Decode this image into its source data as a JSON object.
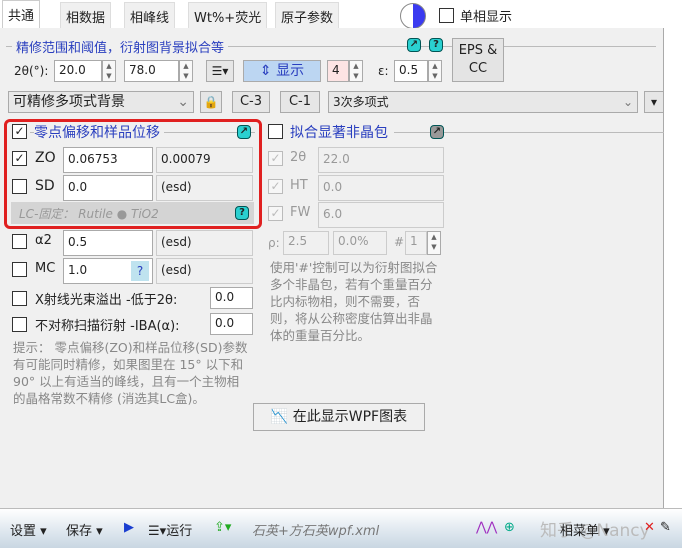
{
  "tabs": [
    "共通",
    "相数据",
    "相峰线",
    "Wt%+荧光",
    "原子参数"
  ],
  "single_phase": "单相显示",
  "range_section": {
    "title": "精修范围和阈值，衍射图背景拟合等",
    "two_theta_label": "2θ(°):",
    "min": "20.0",
    "max": "78.0",
    "show_label": "显示",
    "count": "4",
    "epsilon_label": "ε:",
    "epsilon": "0.5",
    "eps_button": "EPS & CC"
  },
  "background": {
    "type": "可精修多项式背景",
    "c3": "C-3",
    "c1": "C-1",
    "poly": "3次多项式"
  },
  "zero": {
    "title": "零点偏移和样品位移",
    "zo_label": "ZO",
    "zo": "0.06753",
    "zo_esd": "0.00079",
    "sd_label": "SD",
    "sd": "0.0",
    "sd_esd": "(esd)",
    "lc_fixed": "LC-固定： Rutile ● TiO2"
  },
  "a2": {
    "label": "α2",
    "value": "0.5",
    "esd": "(esd)"
  },
  "mc": {
    "label": "MC",
    "value": "1.0",
    "help": "?",
    "esd": "(esd)"
  },
  "overflow": {
    "label": "X射线光束溢出 -低于2θ:",
    "value": "0.0"
  },
  "asym": {
    "label": "不对称扫描衍射 -IBA(α):",
    "value": "0.0"
  },
  "hint": "提示： 零点偏移(ZO)和样品位移(SD)参数有可能同时精修，如果图里在 15° 以下和 90° 以上有适当的峰线，且有一个主物相的晶格常数不精修 (消选其LC盒)。",
  "amorphous": {
    "title": "拟合显著非晶包",
    "t_label": "2θ",
    "t": "22.0",
    "ht_label": "HT",
    "ht": "0.0",
    "fw_label": "FW",
    "fw": "6.0",
    "rho_label": "ρ:",
    "rho": "2.5",
    "pct": "0.0%",
    "hash": "#",
    "n": "1",
    "note": "使用'#'控制可以为衍射图拟合多个非晶包，若有个重量百分比内标物相，则不需要，否则，将从公称密度估算出非晶体的重量百分比。"
  },
  "wpf_button": "在此显示WPF图表",
  "toolbar": {
    "settings": "设置",
    "save": "保存",
    "run": "运行",
    "file": "石英+方石英wpf.xml",
    "phase_menu": "相菜单",
    "watermark": "知乎 @Nancy"
  }
}
